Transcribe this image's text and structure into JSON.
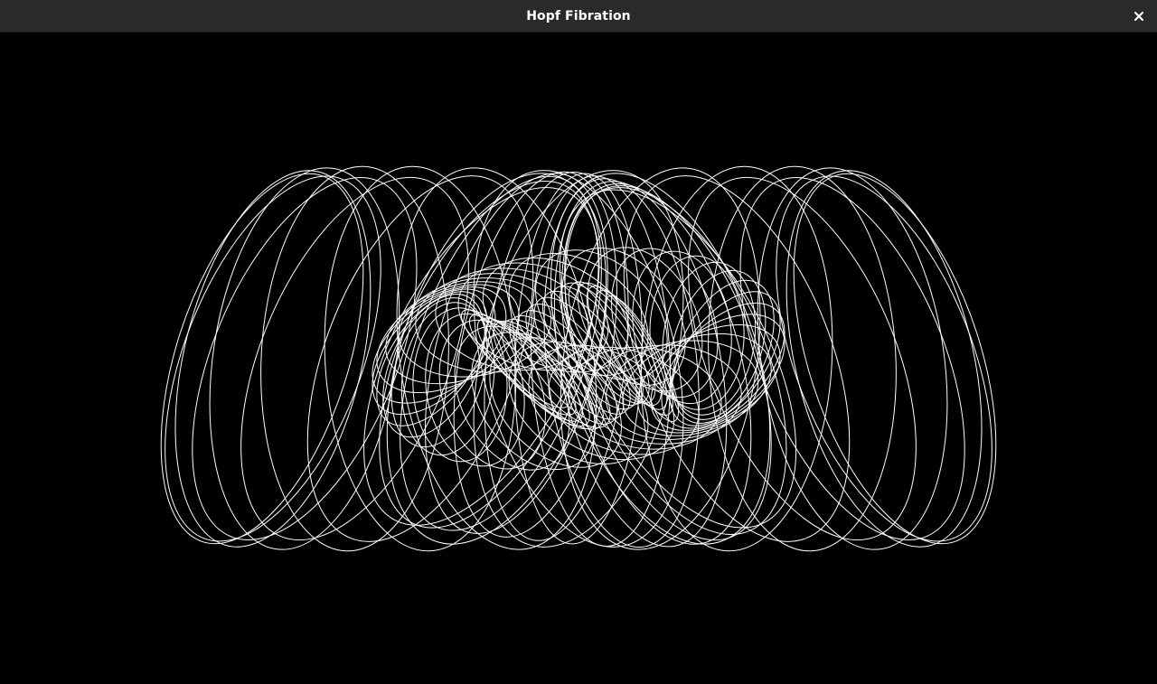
{
  "window": {
    "title": "Hopf Fibration"
  },
  "titlebar": {
    "close_icon": "close-icon"
  },
  "canvas": {
    "background": "#000000",
    "stroke_color": "#ffffff"
  }
}
